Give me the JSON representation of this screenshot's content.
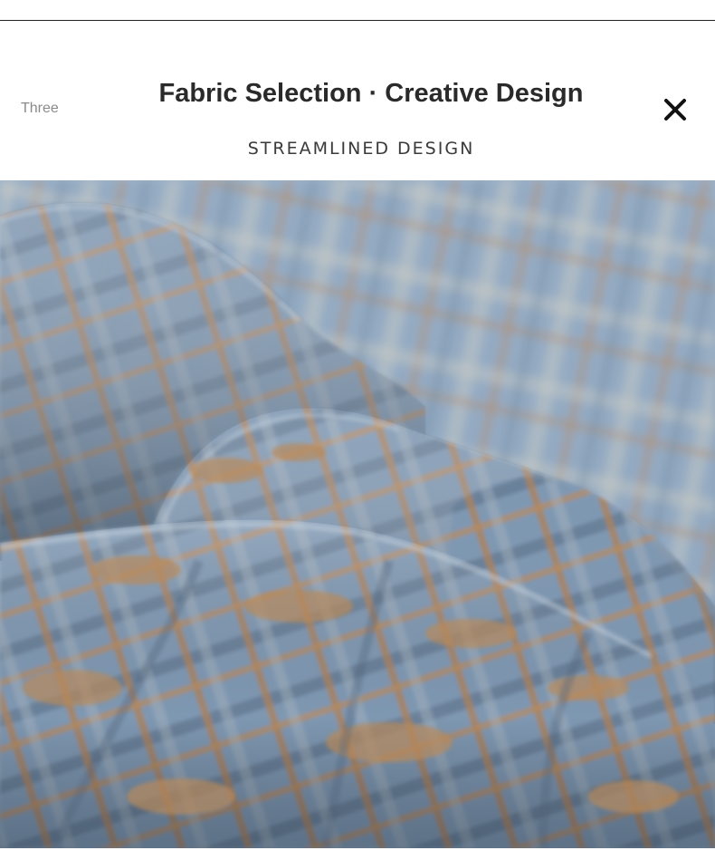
{
  "header": {
    "step_label": "Three",
    "title": "Fabric Selection · Creative Design",
    "subtitle": "STREAMLINED DESIGN"
  },
  "icons": {
    "close": "close-icon"
  },
  "photo": {
    "subject": "blue-and-tan-plaid-wool-fabric",
    "colors": {
      "blue": "#8ba4be",
      "blue_dark": "#5f7892",
      "tan": "#b58b62",
      "cream": "#d9d4c8"
    }
  }
}
